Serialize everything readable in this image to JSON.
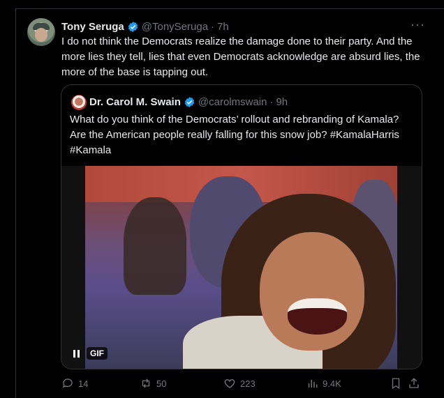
{
  "tweet": {
    "author_name": "Tony Seruga",
    "author_handle": "@TonySeruga",
    "separator": "·",
    "time": "7h",
    "more": "···",
    "text": "I do not think the Democrats realize the damage done to their party. And the more lies they tell, lies that even Democrats acknowledge are absurd lies, the more of the base is tapping out."
  },
  "quote": {
    "author_name": "Dr. Carol M. Swain",
    "author_handle": "@carolmswain",
    "separator": "·",
    "time": "9h",
    "text": "What do you think of the Democrats’ rollout and rebranding of Kamala? Are the American people really falling for this snow job?  #KamalaHarris #Kamala",
    "media_badge": "GIF"
  },
  "actions": {
    "replies": "14",
    "reposts": "50",
    "likes": "223",
    "views": "9.4K"
  },
  "colors": {
    "verified": "#1d9bf0",
    "muted": "#71767b",
    "border": "#2f3336"
  }
}
